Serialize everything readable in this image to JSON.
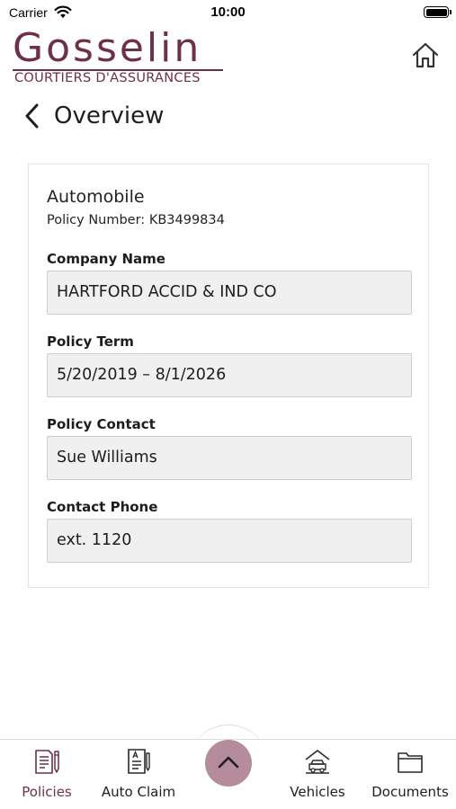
{
  "status_bar": {
    "carrier": "Carrier",
    "time": "10:00"
  },
  "brand": {
    "name": "Gosselin",
    "tagline": "COURTIERS D'ASSURANCES",
    "color": "#6e2f4a"
  },
  "header": {
    "home_icon": "home-icon",
    "back_icon": "chevron-left-icon",
    "title": "Overview"
  },
  "policy": {
    "type": "Automobile",
    "number_label": "Policy Number:",
    "number": "KB3499834",
    "fields": [
      {
        "label": "Company Name",
        "value": "HARTFORD ACCID & IND CO"
      },
      {
        "label": "Policy Term",
        "value": "5/20/2019 – 8/1/2026"
      },
      {
        "label": "Policy Contact",
        "value": "Sue Williams"
      },
      {
        "label": "Contact Phone",
        "value": "ext. 1120"
      }
    ]
  },
  "tabbar": {
    "accent_color": "#6e2f4a",
    "fab_color": "#b58c9c",
    "fab_icon": "chevron-up-icon",
    "tabs": [
      {
        "label": "Policies",
        "icon": "policy-document-icon",
        "active": true
      },
      {
        "label": "Auto Claim",
        "icon": "claim-form-icon",
        "active": false
      },
      {
        "label": "Vehicles",
        "icon": "car-garage-icon",
        "active": false
      },
      {
        "label": "Documents",
        "icon": "folder-icon",
        "active": false
      }
    ]
  }
}
